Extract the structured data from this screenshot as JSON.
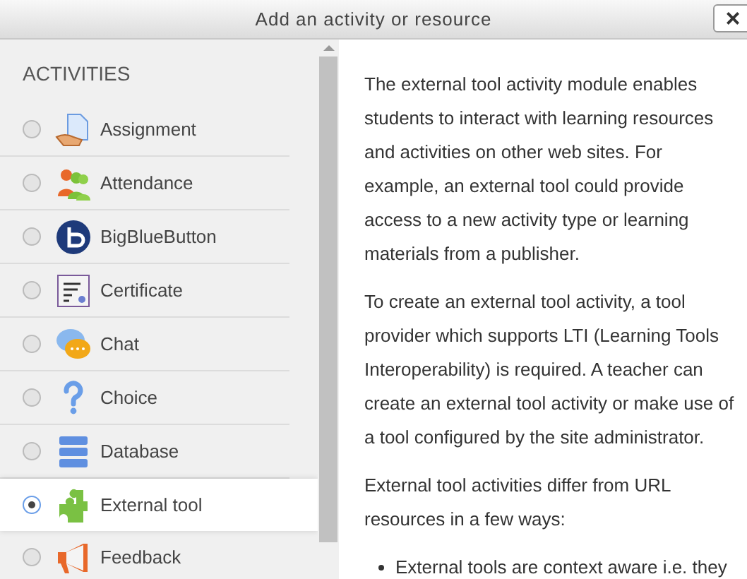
{
  "window": {
    "title": "Add an activity or resource",
    "close": "×"
  },
  "sidebar": {
    "heading": "ACTIVITIES",
    "items": [
      {
        "label": "Assignment",
        "kind": "assignment",
        "selected": false
      },
      {
        "label": "Attendance",
        "kind": "attendance",
        "selected": false
      },
      {
        "label": "BigBlueButton",
        "kind": "bigbluebutton",
        "selected": false
      },
      {
        "label": "Certificate",
        "kind": "certificate",
        "selected": false
      },
      {
        "label": "Chat",
        "kind": "chat",
        "selected": false
      },
      {
        "label": "Choice",
        "kind": "choice",
        "selected": false
      },
      {
        "label": "Database",
        "kind": "database",
        "selected": false
      },
      {
        "label": "External tool",
        "kind": "puzzle",
        "selected": true
      },
      {
        "label": "Feedback",
        "kind": "megaphone",
        "selected": false
      }
    ]
  },
  "description": {
    "paragraphs": [
      "The external tool activity module enables students to interact with learning resources and activities on other web sites. For example, an external tool could provide access to a new activity type or learning materials from a publisher.",
      "To create an external tool activity, a tool provider which supports LTI (Learning Tools Interoperability) is required. A teacher can create an external tool activity or make use of a tool configured by the site administrator.",
      "External tool activities differ from URL resources in a few ways:"
    ],
    "bullets": [
      "External tools are context aware i.e. they"
    ]
  }
}
